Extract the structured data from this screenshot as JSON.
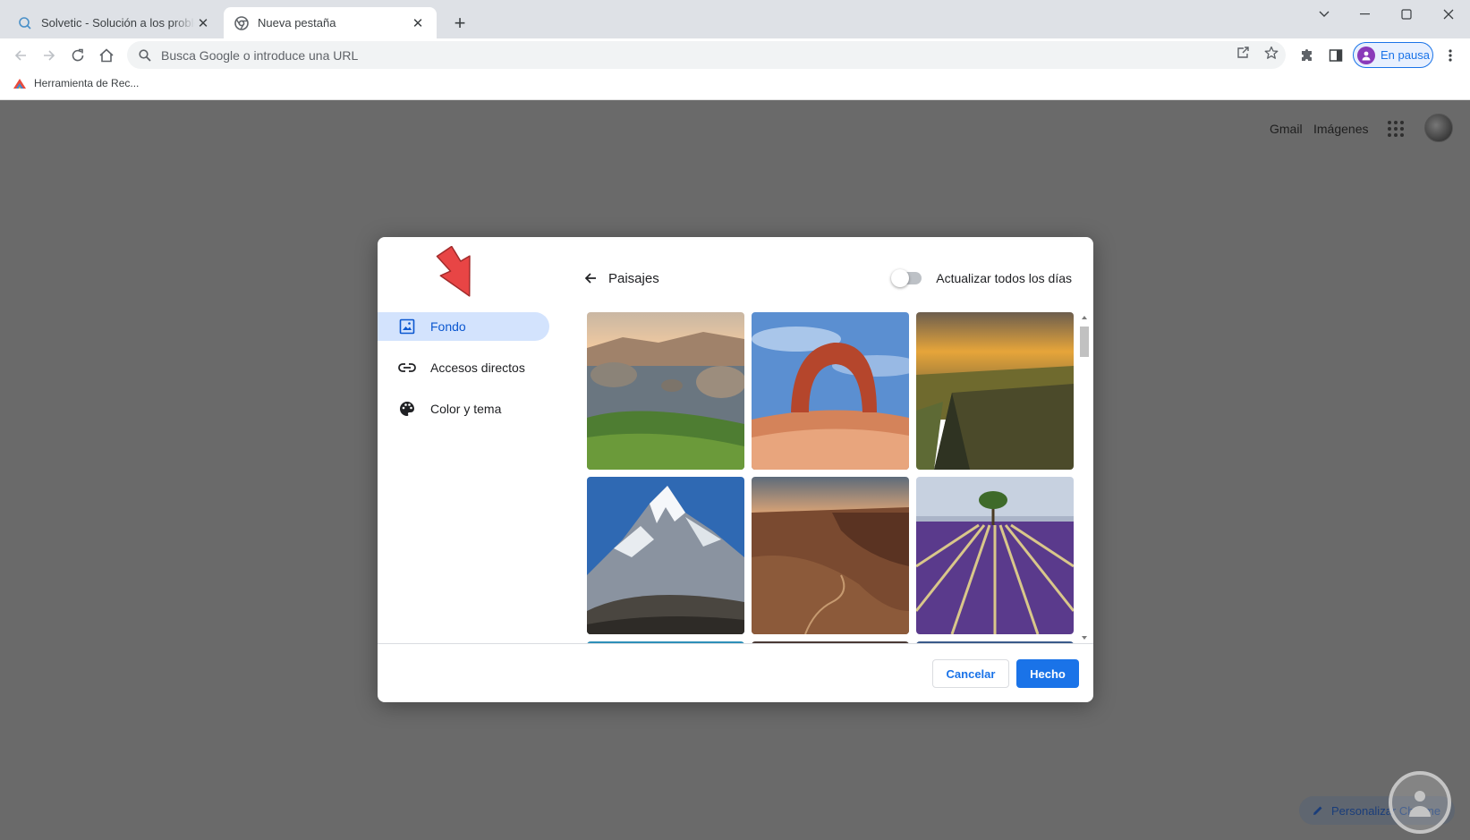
{
  "browser": {
    "tabs": [
      {
        "title": "Solvetic - Solución a los problemas",
        "active": false
      },
      {
        "title": "Nueva pestaña",
        "active": true
      }
    ],
    "omnibox_placeholder": "Busca Google o introduce una URL",
    "profile_label": "En pausa",
    "bookmarks": [
      {
        "label": "Herramienta de Rec..."
      }
    ]
  },
  "page": {
    "top_links": [
      "Gmail",
      "Imágenes"
    ],
    "customize_label": "Personalizar Chrome"
  },
  "dialog": {
    "nav": [
      {
        "label": "Fondo",
        "icon": "image-icon",
        "active": true
      },
      {
        "label": "Accesos directos",
        "icon": "link-icon",
        "active": false
      },
      {
        "label": "Color y tema",
        "icon": "palette-icon",
        "active": false
      }
    ],
    "collection_title": "Paisajes",
    "daily_refresh_label": "Actualizar todos los días",
    "daily_refresh_on": false,
    "backgrounds": [
      {
        "name": "coastal-rocks-lake"
      },
      {
        "name": "desert-stone-arch"
      },
      {
        "name": "canyon-sunset"
      },
      {
        "name": "snowy-mountain-peak"
      },
      {
        "name": "red-rock-valley"
      },
      {
        "name": "lavender-field-tree"
      }
    ],
    "cancel_label": "Cancelar",
    "done_label": "Hecho"
  },
  "colors": {
    "accent": "#1a73e8",
    "nav_active_bg": "#d3e3fd",
    "overlay": "#6a6a6a",
    "annotation_arrow": "#e84545"
  }
}
